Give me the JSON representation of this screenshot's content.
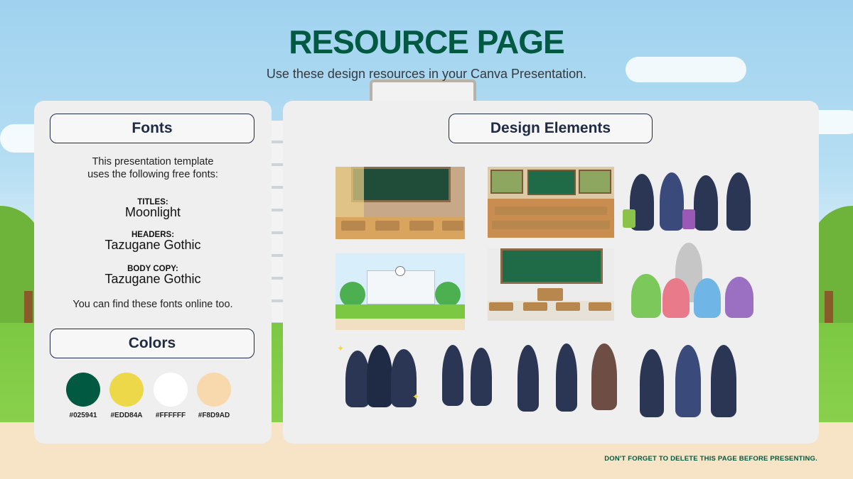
{
  "header": {
    "title": "RESOURCE PAGE",
    "subtitle": "Use these design resources in your Canva Presentation."
  },
  "fonts_panel": {
    "heading": "Fonts",
    "intro_line1": "This presentation template",
    "intro_line2": "uses the following free fonts:",
    "entries": [
      {
        "label": "TITLES:",
        "value": "Moonlight"
      },
      {
        "label": "HEADERS:",
        "value": "Tazugane Gothic"
      },
      {
        "label": "BODY COPY:",
        "value": "Tazugane Gothic"
      }
    ],
    "note": "You can find these fonts online too."
  },
  "colors_panel": {
    "heading": "Colors",
    "swatches": [
      {
        "hex": "#025941",
        "label": "#025941"
      },
      {
        "hex": "#EDD84A",
        "label": "#EDD84A"
      },
      {
        "hex": "#FFFFFF",
        "label": "#FFFFFF"
      },
      {
        "hex": "#F8D9AD",
        "label": "#F8D9AD"
      }
    ]
  },
  "design_panel": {
    "heading": "Design Elements",
    "elements": [
      {
        "name": "classroom-chalkboard-illustration"
      },
      {
        "name": "classroom-with-bulletin-boards-illustration"
      },
      {
        "name": "students-with-luggage-illustration"
      },
      {
        "name": "school-building-illustration"
      },
      {
        "name": "chalkboard-and-desks-illustration"
      },
      {
        "name": "teacher-with-students-illustration"
      },
      {
        "name": "cheering-students-group-illustration"
      },
      {
        "name": "students-walking-illustration"
      },
      {
        "name": "students-and-teacher-illustration"
      },
      {
        "name": "students-pointing-illustration"
      }
    ]
  },
  "footer": {
    "text": "DON'T FORGET TO DELETE THIS PAGE BEFORE PRESENTING."
  },
  "colors": {
    "accent": "#025941",
    "pill_border": "#1f2a44",
    "panel_bg": "#efefef"
  }
}
